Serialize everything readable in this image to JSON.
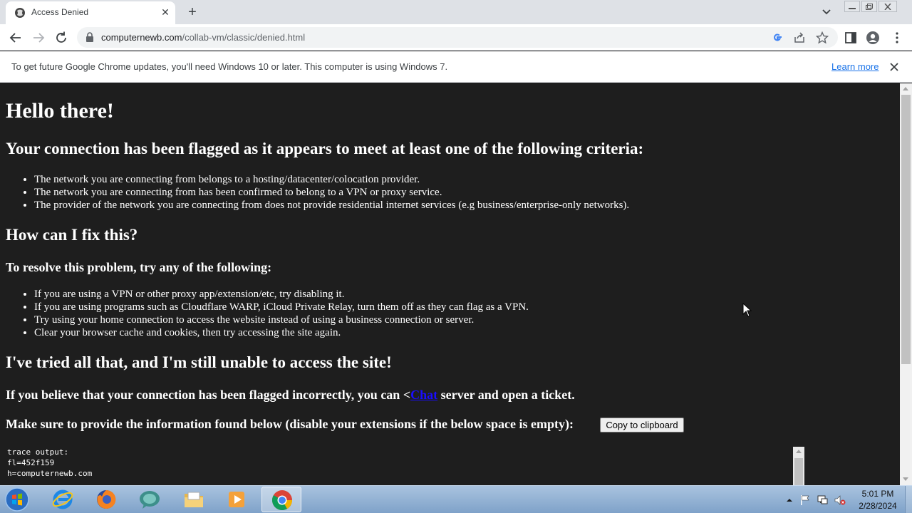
{
  "browser": {
    "tab_title": "Access Denied",
    "url_host": "computernewb.com",
    "url_path": "/collab-vm/classic/denied.html"
  },
  "infobar": {
    "message": "To get future Google Chrome updates, you'll need Windows 10 or later. This computer is using Windows 7.",
    "link": "Learn more"
  },
  "page": {
    "greeting": "Hello there!",
    "flagged_heading": "Your connection has been flagged as it appears to meet at least one of the following criteria:",
    "criteria": [
      "The network you are connecting from belongs to a hosting/datacenter/colocation provider.",
      "The network you are connecting from has been confirmed to belong to a VPN or proxy service.",
      "The provider of the network you are connecting from does not provide residential internet services (e.g business/enterprise-only networks)."
    ],
    "fix_heading": "How can I fix this?",
    "resolve_heading": "To resolve this problem, try any of the following:",
    "fixes": [
      "If you are using a VPN or other proxy app/extension/etc, try disabling it.",
      "If you are using programs such as Cloudflare WARP, iCloud Private Relay, turn them off as they can flag as a VPN.",
      "Try using your home connection to access the website instead of using a business connection or server.",
      "Clear your browser cache and cookies, then try accessing the site again."
    ],
    "tried_heading": "I've tried all that, and I'm still unable to access the site!",
    "incorrect_prefix": "If you believe that your connection has been flagged incorrectly, you can <",
    "incorrect_link": "Chat",
    "incorrect_suffix": " server and open a ticket.",
    "provide_text": "Make sure to provide the information found below (disable your extensions if the below space is empty):",
    "copy_button": "Copy to clipboard",
    "trace_lines": [
      "trace output:",
      "",
      "fl=452f159",
      "h=computernewb.com"
    ]
  },
  "taskbar": {
    "time": "5:01 PM",
    "date": "2/28/2024",
    "apps": [
      "start-orb",
      "internet-explorer",
      "firefox",
      "chat-app",
      "file-explorer",
      "media-player",
      "chrome"
    ]
  },
  "colors": {
    "page_bg": "#1e1e1e",
    "link_blue": "#1a0dff",
    "chrome_link": "#1a73e8"
  }
}
